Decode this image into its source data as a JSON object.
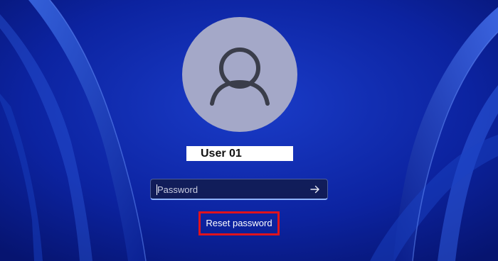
{
  "lock_screen": {
    "user": {
      "avatar_icon": "user-silhouette-icon",
      "display_name": "User 01"
    },
    "password_field": {
      "placeholder": "Password",
      "value": "",
      "submit_icon": "arrow-right-icon"
    },
    "reset_password_label": "Reset password",
    "highlight_color": "#e0131d",
    "background_color": "#0a1f8a"
  }
}
